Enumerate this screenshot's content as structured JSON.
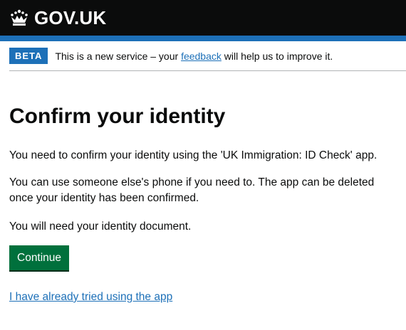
{
  "header": {
    "logo_text": "GOV.UK",
    "logo_icon": "crown-icon",
    "colors": {
      "background": "#0b0c0c",
      "accent_bar": "#1d70b8"
    }
  },
  "phase_banner": {
    "tag": "BETA",
    "text_before": "This is a new service – your ",
    "link_text": "feedback",
    "text_after": " will help us to improve it."
  },
  "main": {
    "heading": "Confirm your identity",
    "paragraphs": [
      "You need to confirm your identity using the 'UK Immigration: ID Check' app.",
      "You can use someone else's phone if you need to. The app can be deleted once your identity has been confirmed.",
      "You will need your identity document."
    ],
    "continue_button": "Continue",
    "secondary_link": "I have already tried using the app"
  },
  "colors": {
    "link": "#1d70b8",
    "button": "#00703c",
    "text": "#0b0c0c"
  }
}
